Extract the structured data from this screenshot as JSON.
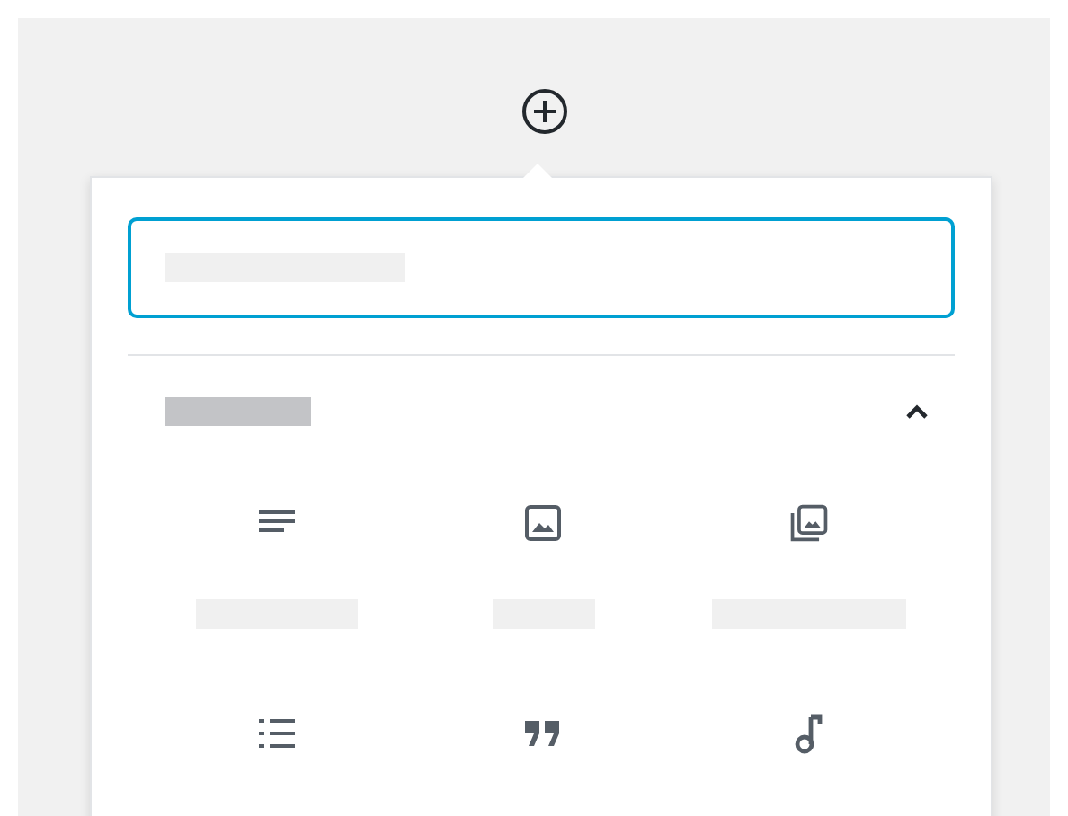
{
  "inserter": {
    "search": {
      "focused": true
    },
    "section": {
      "expanded": true,
      "blocks": [
        {
          "kind": "paragraph",
          "label_shown": true
        },
        {
          "kind": "image",
          "label_shown": true
        },
        {
          "kind": "gallery",
          "label_shown": true
        },
        {
          "kind": "list",
          "label_shown": false
        },
        {
          "kind": "quote",
          "label_shown": false
        },
        {
          "kind": "audio",
          "label_shown": false
        }
      ]
    }
  }
}
